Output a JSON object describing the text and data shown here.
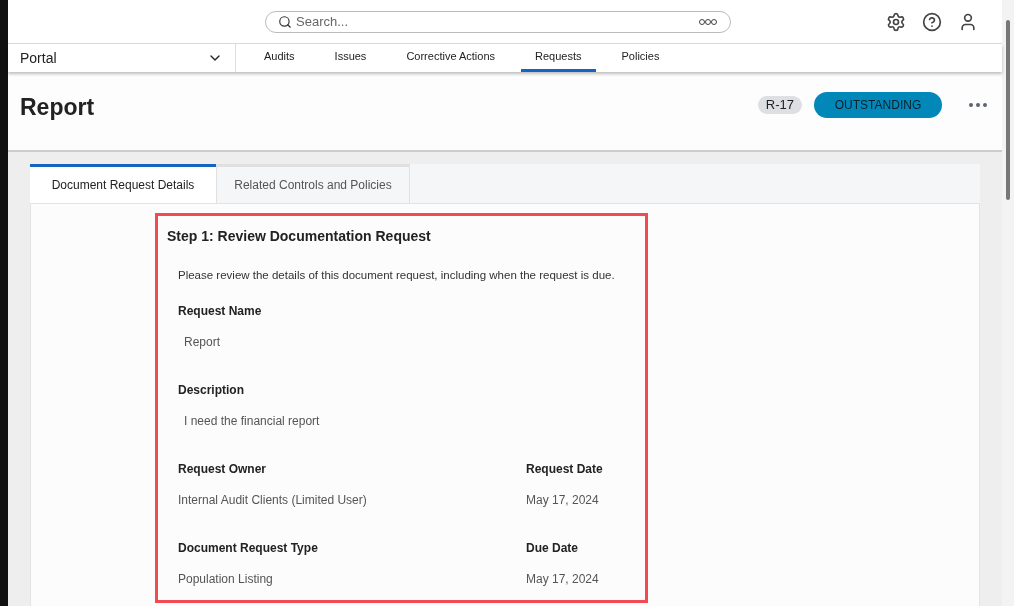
{
  "search": {
    "placeholder": "Search..."
  },
  "nav": {
    "portal": "Portal",
    "tabs": [
      {
        "label": "Audits",
        "selected": false
      },
      {
        "label": "Issues",
        "selected": false
      },
      {
        "label": "Corrective Actions",
        "selected": false
      },
      {
        "label": "Requests",
        "selected": true
      },
      {
        "label": "Policies",
        "selected": false
      }
    ]
  },
  "header": {
    "title": "Report",
    "id_badge": "R-17",
    "status": "OUTSTANDING"
  },
  "content_tabs": [
    {
      "label": "Document Request Details",
      "selected": true
    },
    {
      "label": "Related Controls and Policies",
      "selected": false
    }
  ],
  "step": {
    "title": "Step 1: Review Documentation Request",
    "intro": "Please review the details of this document request, including when the request is due.",
    "rows": [
      [
        {
          "label": "Request Name",
          "value": "Report"
        }
      ],
      [
        {
          "label": "Description",
          "value": "I need the financial report"
        }
      ],
      [
        {
          "label": "Request Owner",
          "value": "Internal Audit Clients (Limited User)"
        },
        {
          "label": "Request Date",
          "value": "May 17, 2024"
        }
      ],
      [
        {
          "label": "Document Request Type",
          "value": "Population Listing"
        },
        {
          "label": "Due Date",
          "value": "May 17, 2024"
        }
      ]
    ]
  }
}
